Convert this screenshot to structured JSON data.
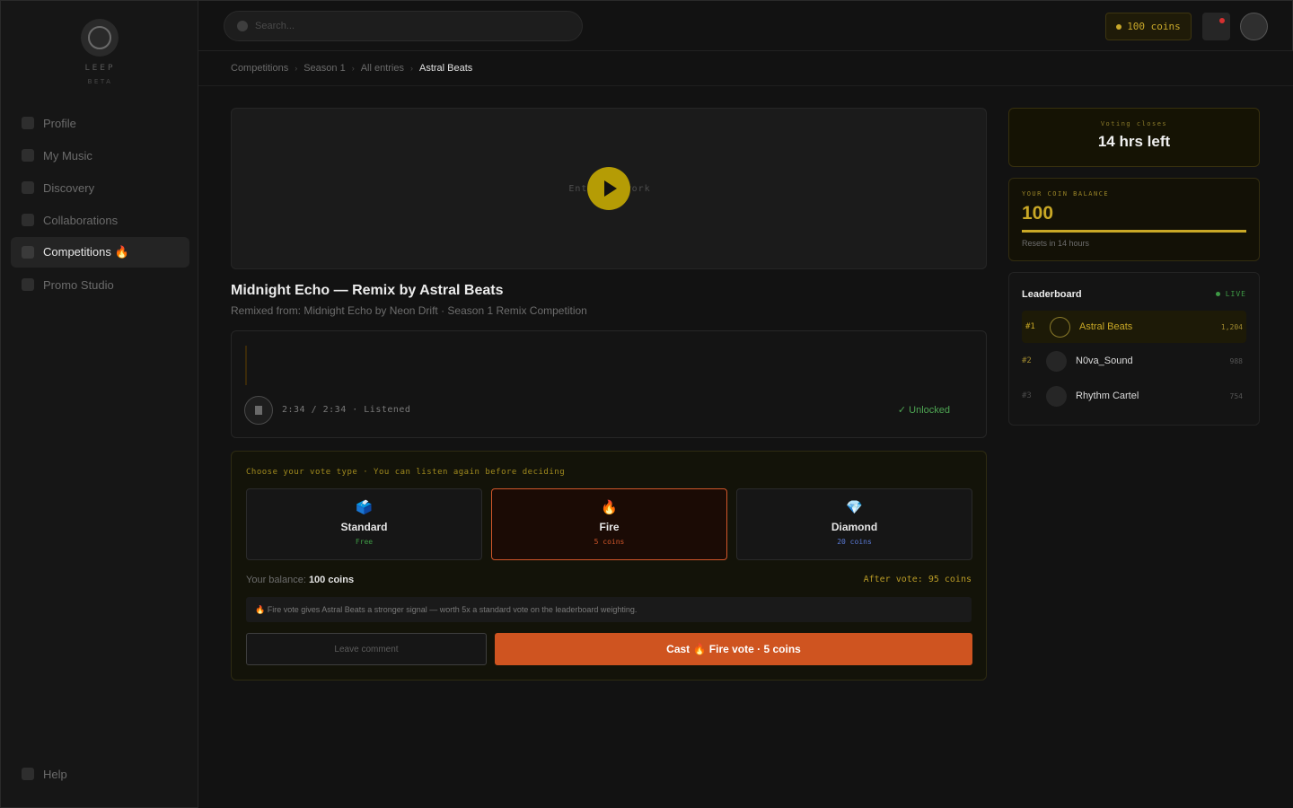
{
  "app": {
    "logo_text": "LEEP",
    "logo_sub": "BETA"
  },
  "sidebar": {
    "items": [
      {
        "label": "Profile"
      },
      {
        "label": "My Music"
      },
      {
        "label": "Discovery"
      },
      {
        "label": "Collaborations"
      },
      {
        "label": "Competitions 🔥",
        "active": true
      },
      {
        "label": "Promo Studio"
      }
    ],
    "help_label": "Help"
  },
  "topbar": {
    "search_placeholder": "Search...",
    "coins_label": "100 coins"
  },
  "breadcrumb": [
    "Competitions",
    "Season 1",
    "All entries",
    "Astral Beats"
  ],
  "player": {
    "artwork_label": "Entry Artwork",
    "title": "Midnight Echo — Remix by Astral Beats",
    "subtitle": "Remixed from: Midnight Echo by Neon Drift · Season 1 Remix Competition",
    "time": "2:34 / 2:34 · Listened",
    "status": "✓ Unlocked"
  },
  "vote": {
    "heading": "Choose your vote type · You can listen again before deciding",
    "options": [
      {
        "icon": "🗳️",
        "name": "Standard",
        "price": "Free",
        "price_color": "#3e9a45"
      },
      {
        "icon": "🔥",
        "name": "Fire",
        "price": "5 coins",
        "price_color": "#d0562a",
        "selected": true
      },
      {
        "icon": "💎",
        "name": "Diamond",
        "price": "20 coins",
        "price_color": "#5a7ad6"
      }
    ],
    "balance_label": "Your balance:",
    "balance_value": "100 coins",
    "after_vote": "After vote: 95 coins",
    "info": "🔥 Fire vote gives Astral Beats a stronger signal — worth 5x a standard vote on the leaderboard weighting.",
    "comment_label": "Leave comment",
    "cast_label": "Cast 🔥 Fire vote · 5 coins"
  },
  "right": {
    "closes_label": "Voting closes",
    "closes_value": "14 hrs left",
    "balance_label": "YOUR COIN BALANCE",
    "balance_value": "100",
    "balance_fill": 1.0,
    "reset_label": "Resets in 14 hours",
    "leaderboard_title": "Leaderboard",
    "live_label": "LIVE",
    "leaderboard": [
      {
        "rank": "#1",
        "name": "Astral Beats",
        "score": "1,204"
      },
      {
        "rank": "#2",
        "name": "N0va_Sound",
        "score": "988"
      },
      {
        "rank": "#3",
        "name": "Rhythm Cartel",
        "score": "754"
      }
    ]
  },
  "colors": {
    "accent": "#c9a826",
    "fire": "#cf5420",
    "live": "#3e9a45"
  }
}
